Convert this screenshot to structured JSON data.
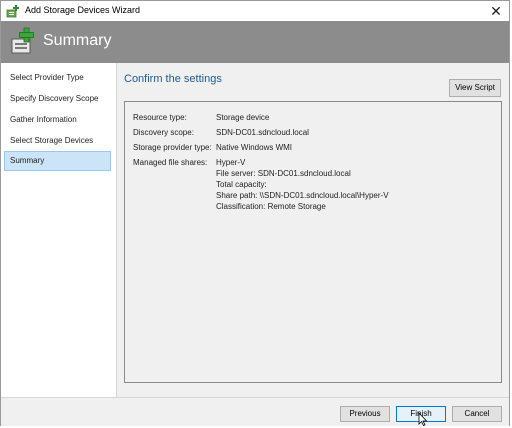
{
  "window": {
    "title": "Add Storage Devices Wizard",
    "close_glyph": "✕"
  },
  "banner": {
    "title": "Summary",
    "icon": "storage-add-icon"
  },
  "sidebar": {
    "items": [
      {
        "label": "Select Provider Type",
        "active": false
      },
      {
        "label": "Specify Discovery Scope",
        "active": false
      },
      {
        "label": "Gather Information",
        "active": false
      },
      {
        "label": "Select Storage Devices",
        "active": false
      },
      {
        "label": "Summary",
        "active": true
      }
    ]
  },
  "main": {
    "section_title": "Confirm the settings",
    "view_script_label": "View Script",
    "settings": [
      {
        "label": "Resource type:",
        "value": "Storage device"
      },
      {
        "label": "Discovery scope:",
        "value": "SDN-DC01.sdncloud.local"
      },
      {
        "label": "Storage provider type:",
        "value": "Native Windows WMI"
      },
      {
        "label": "Managed file shares:",
        "value": "Hyper-V"
      }
    ],
    "share_details": [
      "File server: SDN-DC01.sdncloud.local",
      "Total capacity:",
      "Share path: \\\\SDN-DC01.sdncloud.local\\Hyper-V",
      "Classification: Remote Storage"
    ]
  },
  "footer": {
    "previous_label": "Previous",
    "finish_label": "Finish",
    "cancel_label": "Cancel"
  },
  "colors": {
    "banner": "#8c8c8c",
    "accent_title": "#1f5b8f",
    "selection": "#cce4f7"
  }
}
